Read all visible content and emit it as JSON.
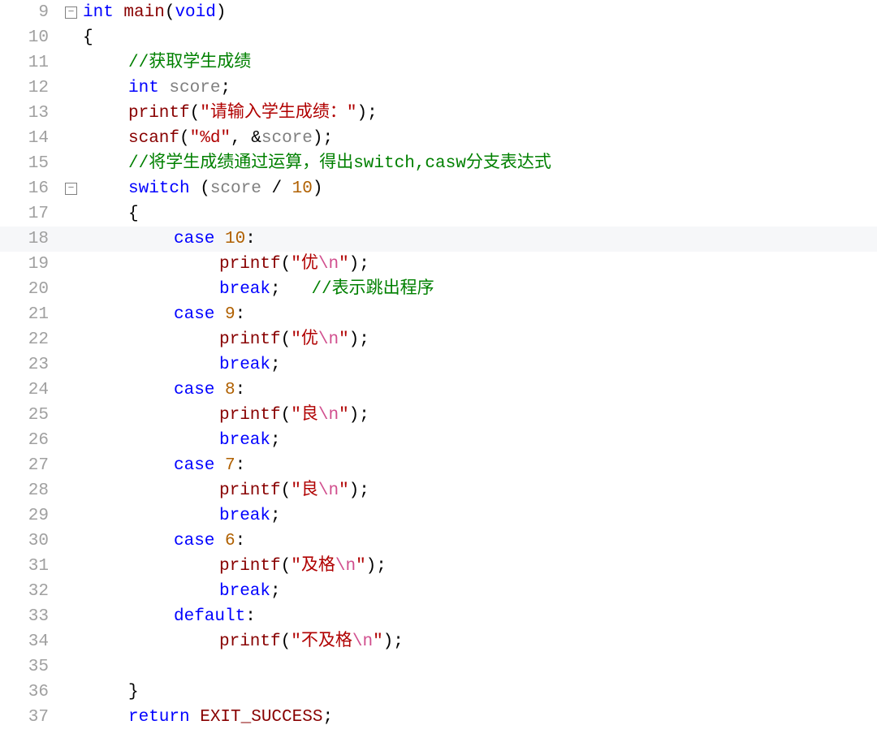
{
  "colors": {
    "keyword": "#0000ff",
    "string": "#b00000",
    "comment": "#008000",
    "func": "#880000",
    "escape": "#d14f8e",
    "number": "#b06000",
    "gutter": "#a0a0a0",
    "change": "#4bdf4b"
  },
  "lines": [
    {
      "n": 9,
      "fold": "minus",
      "change": false,
      "hl": false,
      "indent": 0,
      "guides": [],
      "tokens": [
        {
          "t": "int ",
          "c": "kw"
        },
        {
          "t": "main",
          "c": "fn"
        },
        {
          "t": "(",
          "c": "pn"
        },
        {
          "t": "void",
          "c": "kw"
        },
        {
          "t": ")",
          "c": "pn"
        }
      ]
    },
    {
      "n": 10,
      "fold": "vline",
      "change": false,
      "hl": false,
      "indent": 0,
      "guides": [],
      "tokens": [
        {
          "t": "{",
          "c": "pn"
        }
      ]
    },
    {
      "n": 11,
      "fold": "vline",
      "change": true,
      "hl": false,
      "indent": 1,
      "guides": [
        0
      ],
      "tokens": [
        {
          "t": "//获取学生成绩",
          "c": "cmt"
        }
      ]
    },
    {
      "n": 12,
      "fold": "vline",
      "change": true,
      "hl": false,
      "indent": 1,
      "guides": [
        0
      ],
      "tokens": [
        {
          "t": "int ",
          "c": "kw"
        },
        {
          "t": "score",
          "c": "id"
        },
        {
          "t": ";",
          "c": "pn"
        }
      ]
    },
    {
      "n": 13,
      "fold": "vline",
      "change": true,
      "hl": false,
      "indent": 1,
      "guides": [
        0
      ],
      "tokens": [
        {
          "t": "printf",
          "c": "fn"
        },
        {
          "t": "(",
          "c": "pn"
        },
        {
          "t": "\"请输入学生成绩：\"",
          "c": "str"
        },
        {
          "t": ")",
          "c": "pn"
        },
        {
          "t": ";",
          "c": "pn"
        }
      ]
    },
    {
      "n": 14,
      "fold": "vline",
      "change": true,
      "hl": false,
      "indent": 1,
      "guides": [
        0
      ],
      "tokens": [
        {
          "t": "scanf",
          "c": "fn"
        },
        {
          "t": "(",
          "c": "pn"
        },
        {
          "t": "\"%d\"",
          "c": "str"
        },
        {
          "t": ", &",
          "c": "pn"
        },
        {
          "t": "score",
          "c": "id"
        },
        {
          "t": ")",
          "c": "pn"
        },
        {
          "t": ";",
          "c": "pn"
        }
      ]
    },
    {
      "n": 15,
      "fold": "vline",
      "change": true,
      "hl": false,
      "indent": 1,
      "guides": [
        0
      ],
      "tokens": [
        {
          "t": "//将学生成绩通过运算，得出",
          "c": "cmt"
        },
        {
          "t": "switch,casw",
          "c": "cmt"
        },
        {
          "t": "分支表达式",
          "c": "cmt"
        }
      ]
    },
    {
      "n": 16,
      "fold": "minus2",
      "change": true,
      "hl": false,
      "indent": 1,
      "guides": [
        0
      ],
      "tokens": [
        {
          "t": "switch ",
          "c": "kw"
        },
        {
          "t": "(",
          "c": "pn"
        },
        {
          "t": "score",
          "c": "id"
        },
        {
          "t": " / ",
          "c": "op"
        },
        {
          "t": "10",
          "c": "num"
        },
        {
          "t": ")",
          "c": "pn"
        }
      ]
    },
    {
      "n": 17,
      "fold": "vline",
      "change": true,
      "hl": false,
      "indent": 1,
      "guides": [
        0
      ],
      "tokens": [
        {
          "t": "{",
          "c": "pn"
        }
      ]
    },
    {
      "n": 18,
      "fold": "vline",
      "change": true,
      "hl": true,
      "indent": 2,
      "guides": [
        0,
        1
      ],
      "tokens": [
        {
          "t": "case ",
          "c": "kw"
        },
        {
          "t": "10",
          "c": "num"
        },
        {
          "t": ":",
          "c": "pn"
        }
      ]
    },
    {
      "n": 19,
      "fold": "vline",
      "change": true,
      "hl": false,
      "indent": 3,
      "guides": [
        0,
        1
      ],
      "tokens": [
        {
          "t": "printf",
          "c": "fn"
        },
        {
          "t": "(",
          "c": "pn"
        },
        {
          "t": "\"优",
          "c": "str"
        },
        {
          "t": "\\n",
          "c": "esc"
        },
        {
          "t": "\"",
          "c": "str"
        },
        {
          "t": ")",
          "c": "pn"
        },
        {
          "t": ";",
          "c": "pn"
        }
      ]
    },
    {
      "n": 20,
      "fold": "vline",
      "change": true,
      "hl": false,
      "indent": 3,
      "guides": [
        0,
        1
      ],
      "tokens": [
        {
          "t": "break",
          "c": "kw"
        },
        {
          "t": ";   ",
          "c": "pn"
        },
        {
          "t": "//表示跳出程序",
          "c": "cmt"
        }
      ]
    },
    {
      "n": 21,
      "fold": "vline",
      "change": true,
      "hl": false,
      "indent": 2,
      "guides": [
        0,
        1
      ],
      "tokens": [
        {
          "t": "case ",
          "c": "kw"
        },
        {
          "t": "9",
          "c": "num"
        },
        {
          "t": ":",
          "c": "pn"
        }
      ]
    },
    {
      "n": 22,
      "fold": "vline",
      "change": true,
      "hl": false,
      "indent": 3,
      "guides": [
        0,
        1
      ],
      "tokens": [
        {
          "t": "printf",
          "c": "fn"
        },
        {
          "t": "(",
          "c": "pn"
        },
        {
          "t": "\"优",
          "c": "str"
        },
        {
          "t": "\\n",
          "c": "esc"
        },
        {
          "t": "\"",
          "c": "str"
        },
        {
          "t": ")",
          "c": "pn"
        },
        {
          "t": ";",
          "c": "pn"
        }
      ]
    },
    {
      "n": 23,
      "fold": "vline",
      "change": true,
      "hl": false,
      "indent": 3,
      "guides": [
        0,
        1
      ],
      "tokens": [
        {
          "t": "break",
          "c": "kw"
        },
        {
          "t": ";",
          "c": "pn"
        }
      ]
    },
    {
      "n": 24,
      "fold": "vline",
      "change": true,
      "hl": false,
      "indent": 2,
      "guides": [
        0,
        1
      ],
      "tokens": [
        {
          "t": "case ",
          "c": "kw"
        },
        {
          "t": "8",
          "c": "num"
        },
        {
          "t": ":",
          "c": "pn"
        }
      ]
    },
    {
      "n": 25,
      "fold": "vline",
      "change": true,
      "hl": false,
      "indent": 3,
      "guides": [
        0,
        1
      ],
      "tokens": [
        {
          "t": "printf",
          "c": "fn"
        },
        {
          "t": "(",
          "c": "pn"
        },
        {
          "t": "\"良",
          "c": "str"
        },
        {
          "t": "\\n",
          "c": "esc"
        },
        {
          "t": "\"",
          "c": "str"
        },
        {
          "t": ")",
          "c": "pn"
        },
        {
          "t": ";",
          "c": "pn"
        }
      ]
    },
    {
      "n": 26,
      "fold": "vline",
      "change": true,
      "hl": false,
      "indent": 3,
      "guides": [
        0,
        1
      ],
      "tokens": [
        {
          "t": "break",
          "c": "kw"
        },
        {
          "t": ";",
          "c": "pn"
        }
      ]
    },
    {
      "n": 27,
      "fold": "vline",
      "change": true,
      "hl": false,
      "indent": 2,
      "guides": [
        0,
        1
      ],
      "tokens": [
        {
          "t": "case ",
          "c": "kw"
        },
        {
          "t": "7",
          "c": "num"
        },
        {
          "t": ":",
          "c": "pn"
        }
      ]
    },
    {
      "n": 28,
      "fold": "vline",
      "change": true,
      "hl": false,
      "indent": 3,
      "guides": [
        0,
        1
      ],
      "tokens": [
        {
          "t": "printf",
          "c": "fn"
        },
        {
          "t": "(",
          "c": "pn"
        },
        {
          "t": "\"良",
          "c": "str"
        },
        {
          "t": "\\n",
          "c": "esc"
        },
        {
          "t": "\"",
          "c": "str"
        },
        {
          "t": ")",
          "c": "pn"
        },
        {
          "t": ";",
          "c": "pn"
        }
      ]
    },
    {
      "n": 29,
      "fold": "vline",
      "change": true,
      "hl": false,
      "indent": 3,
      "guides": [
        0,
        1
      ],
      "tokens": [
        {
          "t": "break",
          "c": "kw"
        },
        {
          "t": ";",
          "c": "pn"
        }
      ]
    },
    {
      "n": 30,
      "fold": "vline",
      "change": true,
      "hl": false,
      "indent": 2,
      "guides": [
        0,
        1
      ],
      "tokens": [
        {
          "t": "case ",
          "c": "kw"
        },
        {
          "t": "6",
          "c": "num"
        },
        {
          "t": ":",
          "c": "pn"
        }
      ]
    },
    {
      "n": 31,
      "fold": "vline",
      "change": true,
      "hl": false,
      "indent": 3,
      "guides": [
        0,
        1
      ],
      "tokens": [
        {
          "t": "printf",
          "c": "fn"
        },
        {
          "t": "(",
          "c": "pn"
        },
        {
          "t": "\"及格",
          "c": "str"
        },
        {
          "t": "\\n",
          "c": "esc"
        },
        {
          "t": "\"",
          "c": "str"
        },
        {
          "t": ")",
          "c": "pn"
        },
        {
          "t": ";",
          "c": "pn"
        }
      ]
    },
    {
      "n": 32,
      "fold": "vline",
      "change": true,
      "hl": false,
      "indent": 3,
      "guides": [
        0,
        1
      ],
      "tokens": [
        {
          "t": "break",
          "c": "kw"
        },
        {
          "t": ";",
          "c": "pn"
        }
      ]
    },
    {
      "n": 33,
      "fold": "vline",
      "change": true,
      "hl": false,
      "indent": 2,
      "guides": [
        0,
        1
      ],
      "tokens": [
        {
          "t": "default",
          "c": "kw"
        },
        {
          "t": ":",
          "c": "pn"
        }
      ]
    },
    {
      "n": 34,
      "fold": "vline",
      "change": true,
      "hl": false,
      "indent": 3,
      "guides": [
        0,
        1
      ],
      "tokens": [
        {
          "t": "printf",
          "c": "fn"
        },
        {
          "t": "(",
          "c": "pn"
        },
        {
          "t": "\"不及格",
          "c": "str"
        },
        {
          "t": "\\n",
          "c": "esc"
        },
        {
          "t": "\"",
          "c": "str"
        },
        {
          "t": ")",
          "c": "pn"
        },
        {
          "t": ";",
          "c": "pn"
        }
      ]
    },
    {
      "n": 35,
      "fold": "vline",
      "change": true,
      "hl": false,
      "indent": 0,
      "guides": [
        0,
        1
      ],
      "tokens": []
    },
    {
      "n": 36,
      "fold": "vline",
      "change": true,
      "hl": false,
      "indent": 1,
      "guides": [
        0
      ],
      "tokens": [
        {
          "t": "}",
          "c": "pn"
        }
      ]
    },
    {
      "n": 37,
      "fold": "vline-half",
      "change": false,
      "hl": false,
      "indent": 1,
      "guides": [
        0
      ],
      "tokens": [
        {
          "t": "return ",
          "c": "kw"
        },
        {
          "t": "EXIT_SUCCESS",
          "c": "fn"
        },
        {
          "t": ";",
          "c": "pn"
        }
      ]
    }
  ]
}
